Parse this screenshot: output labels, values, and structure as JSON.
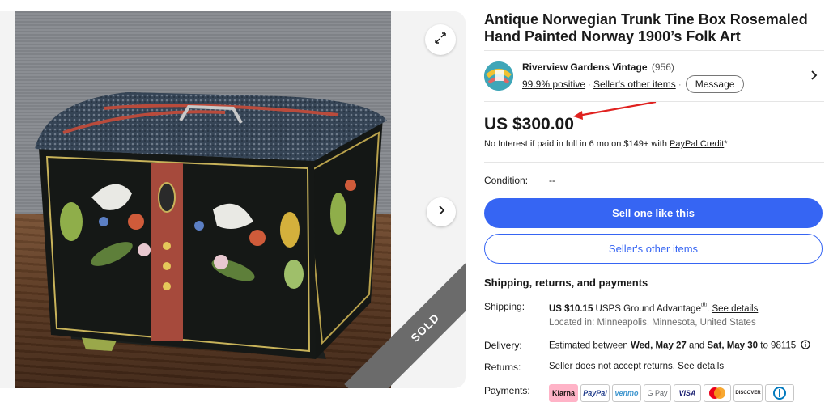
{
  "listing": {
    "title": "Antique Norwegian Trunk Tine Box Rosemaled Hand Painted Norway 1900’s Folk Art",
    "sold_label": "SOLD"
  },
  "seller": {
    "name": "Riverview Gardens Vintage",
    "feedback_count": "(956)",
    "positive": "99.9% positive",
    "separator": "·",
    "other_items_link": "Seller's other items",
    "message_label": "Message"
  },
  "price": {
    "amount": "US $300.00",
    "financing_text": "No Interest if paid in full in 6 mo on $149+ with ",
    "financing_link": "PayPal Credit",
    "financing_suffix": "*"
  },
  "condition": {
    "label": "Condition:",
    "value": "--"
  },
  "actions": {
    "primary": "Sell one like this",
    "secondary": "Seller's other items"
  },
  "shipping": {
    "heading": "Shipping, returns, and payments",
    "shipping_label": "Shipping:",
    "shipping_price": "US $10.15",
    "shipping_service": " USPS Ground Advantage",
    "shipping_reg": "®",
    "shipping_period": ". ",
    "shipping_link": "See details",
    "location": "Located in: Minneapolis, Minnesota, United States",
    "delivery_label": "Delivery:",
    "delivery_prefix": "Estimated between ",
    "delivery_start": "Wed, May 27",
    "delivery_and": " and ",
    "delivery_end": "Sat, May 30",
    "delivery_suffix": " to 98115",
    "returns_label": "Returns:",
    "returns_text": "Seller does not accept returns. ",
    "returns_link": "See details",
    "payments_label": "Payments:"
  },
  "payments": {
    "klarna": "Klarna",
    "paypal": "PayPal",
    "venmo": "venmo",
    "gpay": "G Pay",
    "visa": "VISA",
    "discover": "DISCOVER"
  },
  "colors": {
    "primary_blue": "#3665f3",
    "annotation_red": "#e0211f",
    "sold_ribbon": "#6b6b6b"
  },
  "icons": {
    "expand": "expand-icon",
    "next": "chevron-right-icon",
    "seller_chevron": "chevron-right-icon",
    "info": "info-icon"
  }
}
